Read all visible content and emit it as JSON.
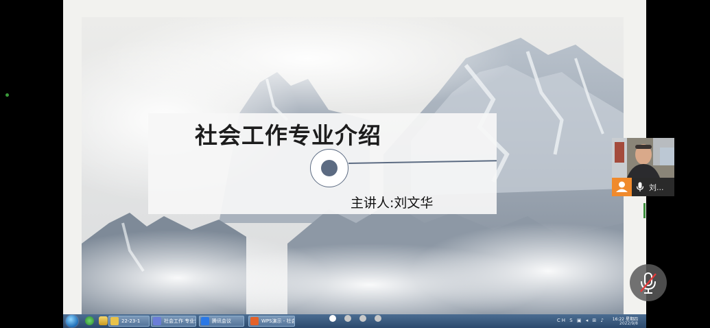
{
  "slide": {
    "title": "社会工作专业介绍",
    "presenter": "主讲人:刘文华"
  },
  "taskbar": {
    "tasks": [
      {
        "label": "22-23-1",
        "icon_color": "#e8c24a"
      },
      {
        "label": "社会工作 专业介...",
        "icon_color": "#6a7dd8"
      },
      {
        "label": "腾讯会议",
        "icon_color": "#2a78e6"
      },
      {
        "label": "WPS演示 - 社会工...",
        "icon_color": "#e4622a"
      }
    ],
    "page_dots": 4,
    "active_dot": 0,
    "tray_time": "16:22 星期四",
    "tray_date": "2022/9/8",
    "tray_icons": "CH S ▣ ◂ ⊞ ♪"
  },
  "participant": {
    "name": "刘...",
    "avatar_color": "#f08a2c"
  },
  "controls": {
    "mute_icon": "mic-muted-icon"
  }
}
